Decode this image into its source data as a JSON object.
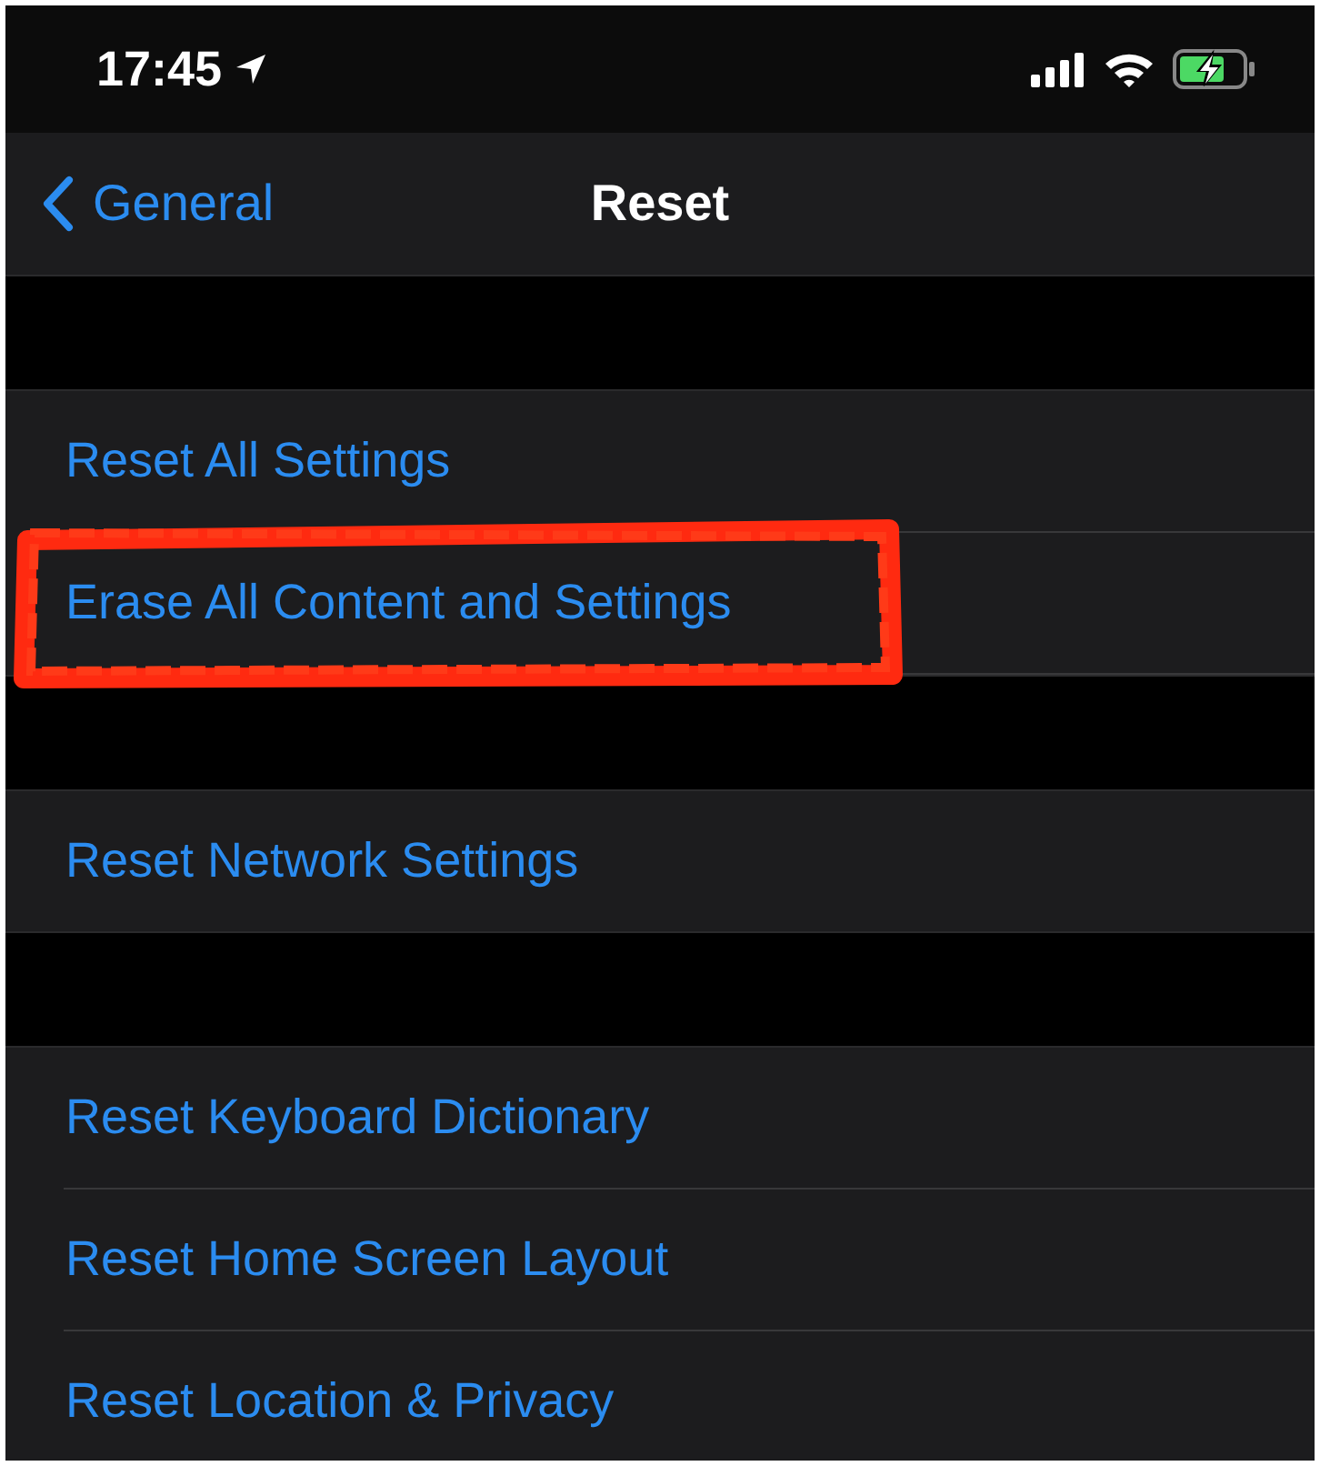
{
  "status_bar": {
    "time": "17:45",
    "location_on": true,
    "battery_charging": true
  },
  "nav": {
    "back_label": "General",
    "title": "Reset"
  },
  "groups": [
    {
      "items": [
        {
          "label": "Reset All Settings",
          "highlighted": false
        },
        {
          "label": "Erase All Content and Settings",
          "highlighted": true
        }
      ]
    },
    {
      "items": [
        {
          "label": "Reset Network Settings",
          "highlighted": false
        }
      ]
    },
    {
      "items": [
        {
          "label": "Reset Keyboard Dictionary",
          "highlighted": false
        },
        {
          "label": "Reset Home Screen Layout",
          "highlighted": false
        },
        {
          "label": "Reset Location & Privacy",
          "highlighted": false
        }
      ]
    }
  ]
}
